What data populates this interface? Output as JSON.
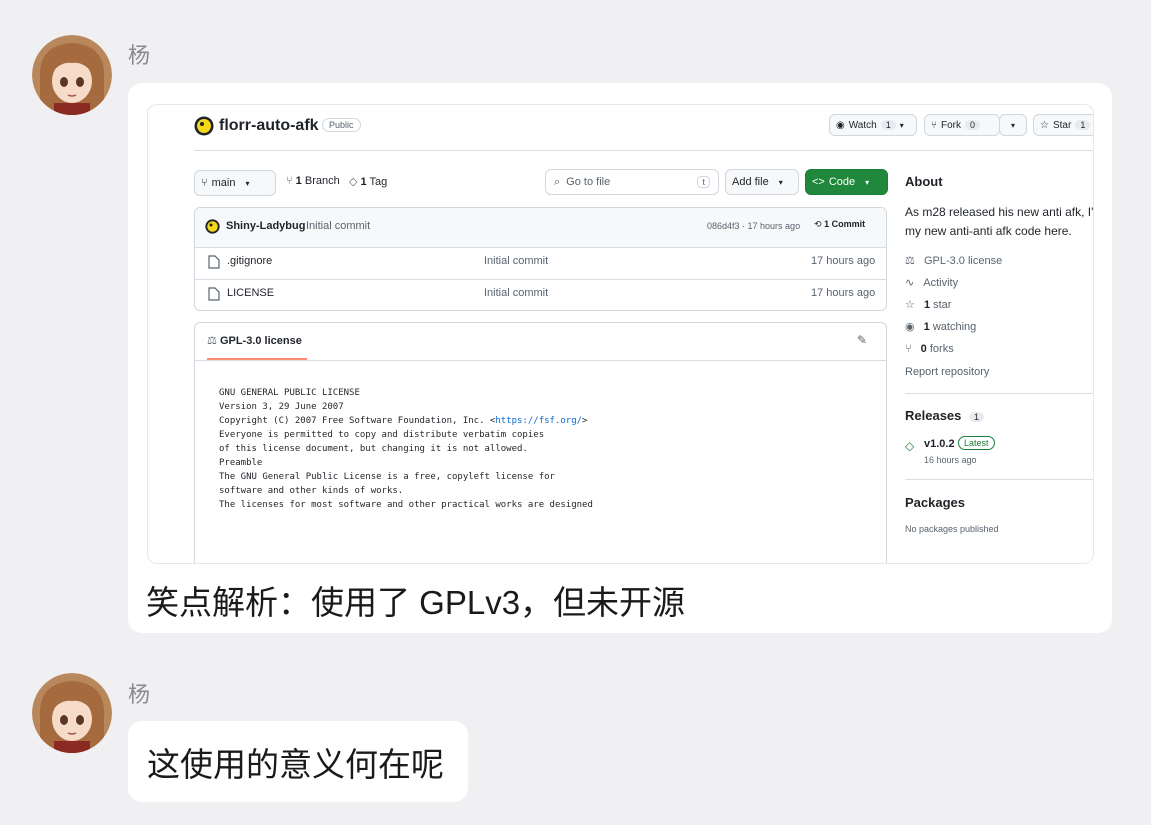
{
  "messages": [
    {
      "sender": "杨",
      "caption": "笑点解析：使用了 GPLv3，但未开源"
    },
    {
      "sender": "杨",
      "text": "这使用的意义何在呢"
    }
  ],
  "github": {
    "repo_name": "florr-auto-afk",
    "visibility": "Public",
    "watch_label": "Watch",
    "watch_count": "1",
    "fork_label": "Fork",
    "fork_count": "0",
    "star_label": "Star",
    "star_count": "1",
    "branch_selector": "main",
    "branches_count": "1",
    "branches_label": "Branch",
    "tags_count": "1",
    "tags_label": "Tag",
    "search_placeholder": "Go to file",
    "search_shortcut": "t",
    "add_file_label": "Add file",
    "code_label": "Code",
    "commit": {
      "author": "Shiny-Ladybug",
      "message": "Initial commit",
      "meta": "086d4f3 · 17 hours ago",
      "commits_count": "1",
      "commits_label": "Commit"
    },
    "files": [
      {
        "name": ".gitignore",
        "message": "Initial commit",
        "time": "17 hours ago"
      },
      {
        "name": "LICENSE",
        "message": "Initial commit",
        "time": "17 hours ago"
      }
    ],
    "license_tab": "GPL-3.0 license",
    "license_lines": [
      "                   GNU GENERAL PUBLIC LICENSE",
      "                      Version 3, 29 June 2007",
      "",
      " Copyright (C) 2007 Free Software Foundation, Inc. <",
      " Everyone is permitted to copy and distribute verbatim copies",
      " of this license document, but changing it is not allowed.",
      "",
      "                            Preamble",
      "",
      "  The GNU General Public License is a free, copyleft license for",
      "software and other kinds of works.",
      "",
      "  The licenses for most software and other practical works are designed"
    ],
    "license_url": "https://fsf.org/",
    "license_url_suffix": ">",
    "about": {
      "heading": "About",
      "description_line1": "As m28 released his new anti afk, I'",
      "description_line2": "my new anti-anti afk code here.",
      "license": "GPL-3.0 license",
      "activity": "Activity",
      "stars_count": "1",
      "stars_label": "star",
      "watching_count": "1",
      "watching_label": "watching",
      "forks_count": "0",
      "forks_label": "forks",
      "report": "Report repository"
    },
    "releases": {
      "heading": "Releases",
      "count": "1",
      "version": "v1.0.2",
      "badge": "Latest",
      "time": "16 hours ago"
    },
    "packages": {
      "heading": "Packages",
      "empty": "No packages published"
    }
  },
  "colors": {
    "code_button": "#1f883d",
    "latest_badge": "#1a7f37",
    "link": "#0969da",
    "tab_underline": "#fd8c73"
  }
}
